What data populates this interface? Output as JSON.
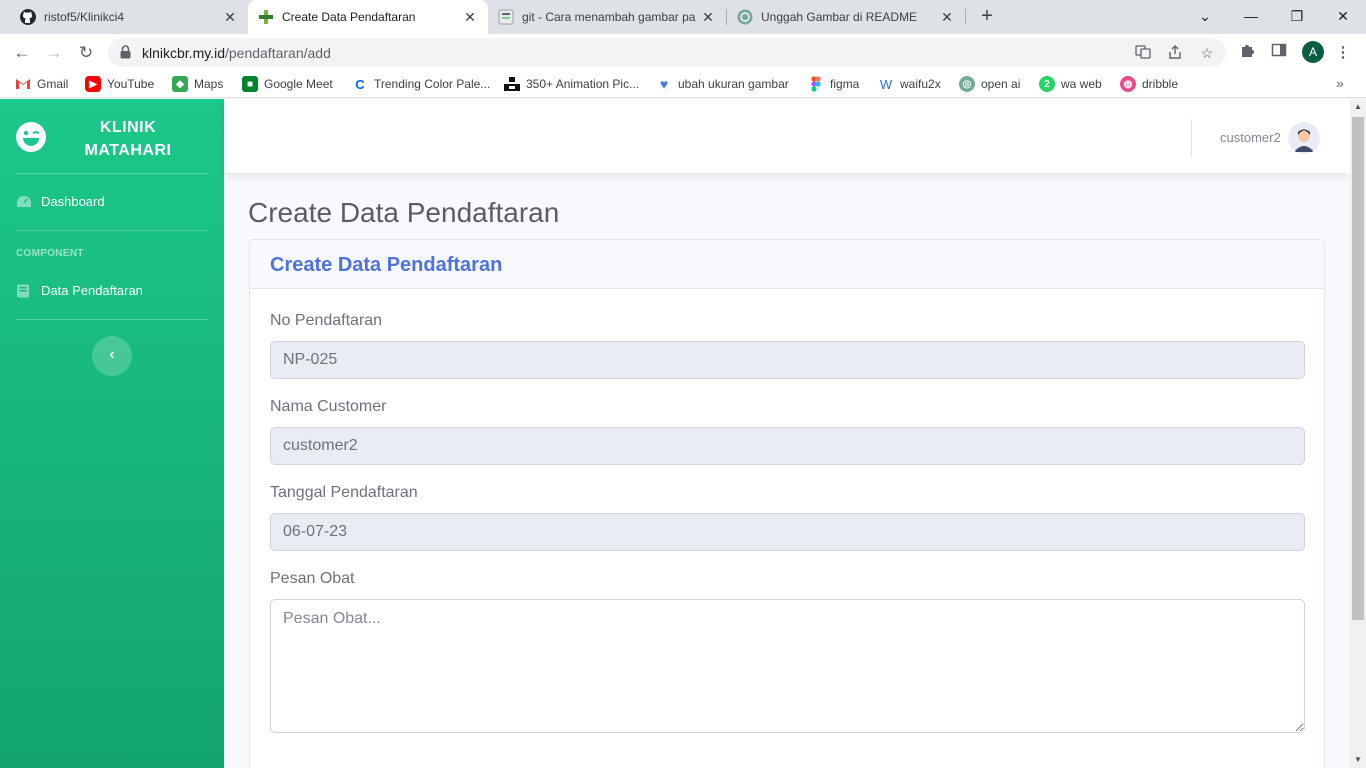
{
  "browser": {
    "tabs": [
      {
        "title": "ristof5/Klinikci4",
        "icon": "github-icon"
      },
      {
        "title": "Create Data Pendaftaran",
        "icon": "clinic-favicon",
        "active": true
      },
      {
        "title": "git - Cara menambah gambar pa",
        "icon": "git-favicon"
      },
      {
        "title": "Unggah Gambar di README",
        "icon": "openai-icon"
      }
    ],
    "url_host": "klnikcbr.my.id",
    "url_path": "/pendaftaran/add",
    "profile_initial": "A",
    "bookmarks": [
      {
        "label": "Gmail",
        "icon": "gmail-icon"
      },
      {
        "label": "YouTube",
        "icon": "youtube-icon"
      },
      {
        "label": "Maps",
        "icon": "maps-icon"
      },
      {
        "label": "Google Meet",
        "icon": "meet-icon"
      },
      {
        "label": "Trending Color Pale...",
        "icon": "coolors-icon"
      },
      {
        "label": "350+ Animation Pic...",
        "icon": "unsplash-icon"
      },
      {
        "label": "ubah ukuran gambar",
        "icon": "heart-icon"
      },
      {
        "label": "figma",
        "icon": "figma-icon"
      },
      {
        "label": "waifu2x",
        "icon": "waifu-icon"
      },
      {
        "label": "open ai",
        "icon": "openai-icon"
      },
      {
        "label": "wa web",
        "icon": "whatsapp-icon"
      },
      {
        "label": "dribble",
        "icon": "dribbble-icon"
      }
    ]
  },
  "sidebar": {
    "brand_line1": "KLINIK",
    "brand_line2": "MATAHARI",
    "dashboard_label": "Dashboard",
    "heading": "COMPONENT",
    "pendaftaran_label": "Data Pendaftaran",
    "toggle_glyph": "‹"
  },
  "topbar": {
    "username": "customer2"
  },
  "main": {
    "page_title": "Create Data Pendaftaran",
    "card_title": "Create Data Pendaftaran",
    "fields": {
      "no_label": "No Pendaftaran",
      "no_value": "NP-025",
      "nama_label": "Nama Customer",
      "nama_value": "customer2",
      "tanggal_label": "Tanggal Pendaftaran",
      "tanggal_value": "06-07-23",
      "pesan_label": "Pesan Obat",
      "pesan_placeholder": "Pesan Obat..."
    }
  },
  "colors": {
    "sidebar_top": "#1cc88a",
    "sidebar_bottom": "#13a46e",
    "primary": "#4e73df",
    "muted_text": "#6e707e",
    "readonly_bg": "#eaecf4"
  }
}
